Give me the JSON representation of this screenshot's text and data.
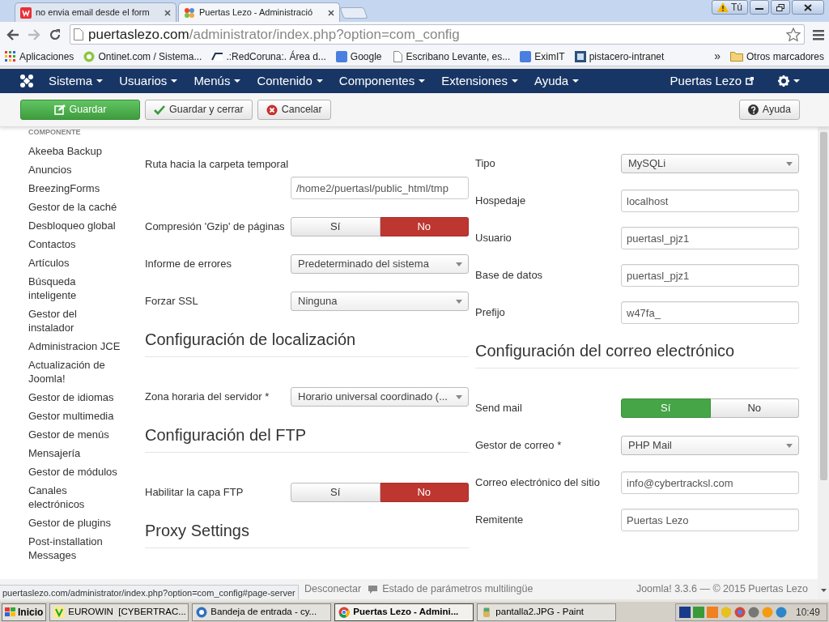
{
  "browser": {
    "tabs": [
      {
        "label": "no envia email desde el form",
        "selected": false
      },
      {
        "label": "Puertas Lezo - Administració",
        "selected": true
      }
    ],
    "user": "Tú",
    "url": {
      "host": "puertaslezo.com",
      "path": "/administrator/index.php?option=com_config"
    },
    "bookmarks": [
      "Aplicaciones",
      "Ontinet.com / Sistema...",
      ".:RedCoruna:. Área d...",
      "Google",
      "Escribano Levante, es...",
      "EximIT",
      "pistacero-intranet"
    ],
    "overflow": "»",
    "other_bookmarks": "Otros marcadores"
  },
  "navbar": {
    "menus": [
      "Sistema",
      "Usuarios",
      "Menús",
      "Contenido",
      "Componentes",
      "Extensiones",
      "Ayuda"
    ],
    "site": "Puertas Lezo"
  },
  "toolbar": {
    "buttons": [
      {
        "label": "Guardar",
        "kind": "save"
      },
      {
        "label": "Guardar y cerrar",
        "kind": "save_close"
      },
      {
        "label": "Cancelar",
        "kind": "cancel"
      }
    ],
    "help": "Ayuda"
  },
  "sidebar": {
    "heading": "COMPONENTE",
    "items": [
      "Akeeba Backup",
      "Anuncios",
      "BreezingForms",
      "Gestor de la caché",
      "Desbloqueo global",
      "Contactos",
      "Artículos",
      "Búsqueda inteligente",
      "Gestor del instalador",
      "Administracion JCE",
      "Actualización de Joomla!",
      "Gestor de idiomas",
      "Gestor multimedia",
      "Gestor de menús",
      "Mensajería",
      "Gestor de módulos",
      "Canales electrónicos",
      "Gestor de plugins",
      "Post-installation Messages"
    ]
  },
  "form": {
    "left": [
      {
        "kind": "field",
        "label": "Ruta hacia la carpeta temporal",
        "label_above": true,
        "control": {
          "kind": "text",
          "value": "/home2/puertasl/public_html/tmp"
        }
      },
      {
        "kind": "field",
        "label": "Compresión 'Gzip' de páginas",
        "control": {
          "kind": "toggle",
          "options": [
            {
              "label": "Sí",
              "selected": false
            },
            {
              "label": "No",
              "selected": true
            }
          ]
        }
      },
      {
        "kind": "field",
        "label": "Informe de errores",
        "control": {
          "kind": "select",
          "value": "Predeterminado del sistema"
        }
      },
      {
        "kind": "field",
        "label": "Forzar SSL",
        "control": {
          "kind": "select",
          "value": "Ninguna"
        }
      },
      {
        "kind": "heading",
        "text": "Configuración de localización"
      },
      {
        "kind": "field",
        "label": "Zona horaria del servidor *",
        "control": {
          "kind": "select",
          "value": "Horario universal coordinado (..."
        }
      },
      {
        "kind": "heading",
        "text": "Configuración del FTP"
      },
      {
        "kind": "field",
        "label": "Habilitar la capa FTP",
        "control": {
          "kind": "toggle",
          "options": [
            {
              "label": "Sí",
              "selected": false
            },
            {
              "label": "No",
              "selected": true
            }
          ]
        }
      },
      {
        "kind": "heading",
        "text": "Proxy Settings"
      }
    ],
    "right": [
      {
        "kind": "field",
        "label": "Tipo",
        "control": {
          "kind": "select",
          "value": "MySQLi"
        }
      },
      {
        "kind": "field",
        "label": "Hospedaje",
        "control": {
          "kind": "text",
          "value": "localhost"
        }
      },
      {
        "kind": "field",
        "label": "Usuario",
        "control": {
          "kind": "text",
          "value": "puertasl_pjz1"
        }
      },
      {
        "kind": "field",
        "label": "Base de datos",
        "control": {
          "kind": "text",
          "value": "puertasl_pjz1"
        }
      },
      {
        "kind": "field",
        "label": "Prefijo",
        "control": {
          "kind": "text",
          "value": "w47fa_"
        }
      },
      {
        "kind": "heading",
        "text": "Configuración del correo electrónico"
      },
      {
        "kind": "field",
        "label": "Send mail",
        "control": {
          "kind": "toggle",
          "options": [
            {
              "label": "Sí",
              "selected": true
            },
            {
              "label": "No",
              "selected": false
            }
          ]
        }
      },
      {
        "kind": "field",
        "label": "Gestor de correo *",
        "control": {
          "kind": "select",
          "value": "PHP Mail"
        }
      },
      {
        "kind": "field",
        "label": "Correo electrónico del sitio",
        "control": {
          "kind": "text",
          "value": "info@cybertracksl.com"
        }
      },
      {
        "kind": "field",
        "label": "Remitente",
        "control": {
          "kind": "text",
          "value": "Puertas Lezo"
        }
      }
    ]
  },
  "footer": {
    "links": [
      "Desconectar",
      "Estado de parámetros multilingüe"
    ],
    "copyright": "Joomla! 3.3.6 — © 2015 Puertas Lezo"
  },
  "status_url": "puertaslezo.com/administrator/index.php?option=com_config#page-server",
  "taskbar": {
    "start": "Inicio",
    "windows": [
      {
        "label": "EUROWIN  [CYBERTRAC...",
        "selected": false
      },
      {
        "label": "Bandeja de entrada - cy...",
        "selected": false
      },
      {
        "label": "Puertas Lezo - Admini...",
        "selected": true
      },
      {
        "label": "pantalla2.JPG - Paint",
        "selected": false
      }
    ],
    "clock": "10:49"
  }
}
